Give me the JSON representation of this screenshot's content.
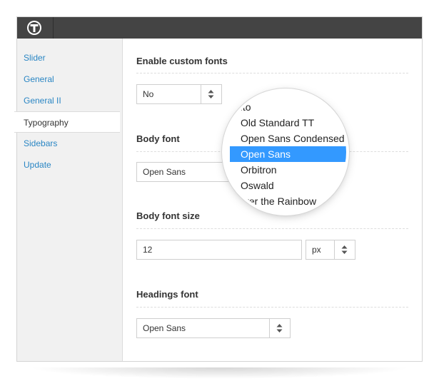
{
  "sidebar": {
    "items": [
      {
        "label": "Slider"
      },
      {
        "label": "General"
      },
      {
        "label": "General II"
      },
      {
        "label": "Typography"
      },
      {
        "label": "Sidebars"
      },
      {
        "label": "Update"
      }
    ],
    "active": "Typography"
  },
  "sections": {
    "custom_fonts": {
      "title": "Enable custom fonts",
      "value": "No"
    },
    "body_font": {
      "title": "Body font",
      "value": "Open Sans"
    },
    "body_font_size": {
      "title": "Body font size",
      "value": "12",
      "unit": "px"
    },
    "headings_font": {
      "title": "Headings font",
      "value": "Open Sans"
    }
  },
  "font_dropdown": {
    "options": [
      "nito",
      "Old Standard TT",
      "Open Sans Condensed",
      "Open Sans",
      "Orbitron",
      "Oswald",
      "Over the Rainbow"
    ],
    "selected": "Open Sans"
  },
  "colors": {
    "topbar": "#444444",
    "link": "#2a86c4",
    "selection": "#3399ff"
  },
  "icons": {
    "logo": "circled-t-logo-icon",
    "select_arrows": "up-down-arrows-icon"
  }
}
